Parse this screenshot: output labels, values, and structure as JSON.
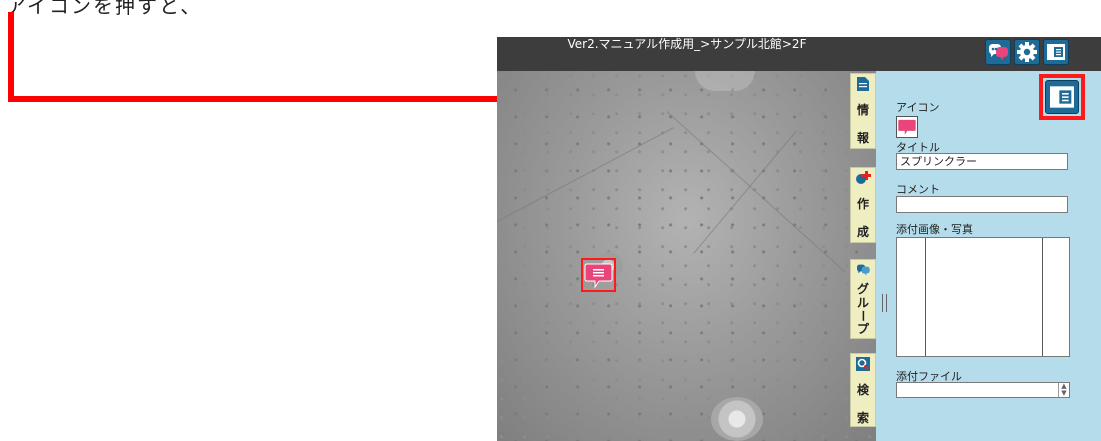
{
  "instruction": {
    "text": "アイコンを押すと、"
  },
  "header": {
    "breadcrumb": "Ver2.マニュアル作成用_>サンプル北館>2F",
    "buttons": [
      "group-icon",
      "gear-icon",
      "panel-toggle-icon"
    ]
  },
  "tabs": [
    {
      "name": "info",
      "chars": [
        "情",
        "報"
      ],
      "icon": "document-icon"
    },
    {
      "name": "create",
      "chars": [
        "作",
        "成"
      ],
      "icon": "add-marker-icon"
    },
    {
      "name": "group",
      "chars": [
        "グ",
        "ル",
        "ー",
        "プ"
      ],
      "icon": "group-icon"
    },
    {
      "name": "search",
      "chars": [
        "検",
        "索"
      ],
      "icon": "search-icon"
    }
  ],
  "panel": {
    "icon_label": "アイコン",
    "title_label": "タイトル",
    "title_value": "スプリンクラー",
    "comment_label": "コメント",
    "comment_value": "",
    "attachment_label": "添付画像・写真",
    "file_label": "添付ファイル",
    "file_value": ""
  },
  "colors": {
    "annotation": "#ff0000",
    "header_bg": "#3d3d3d",
    "button_blue": "#1f6b97",
    "panel_bg": "#b5dcea",
    "tab_bg": "#efeec1",
    "marker_pink": "#e8457a"
  }
}
